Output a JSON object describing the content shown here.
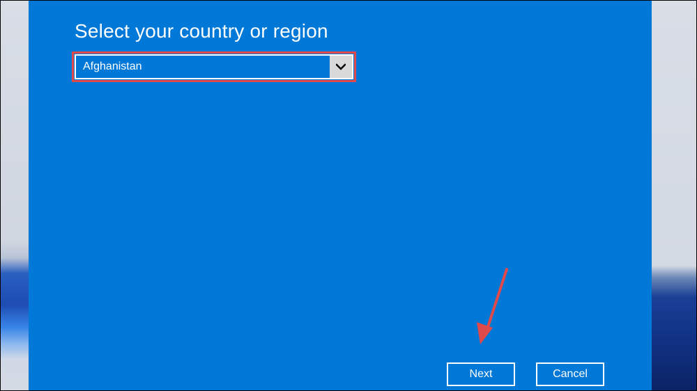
{
  "setup": {
    "title": "Select your country or region",
    "country_select": {
      "selected": "Afghanistan"
    },
    "buttons": {
      "next": "Next",
      "cancel": "Cancel"
    }
  },
  "colors": {
    "oobe_background": "#0078d7",
    "text": "#ffffff",
    "highlight": "#e04a4a",
    "dropdown_arrow_bg": "#d9d9d9"
  },
  "icons": {
    "dropdown": "chevron-down-icon",
    "annotation": "arrow-annotation"
  }
}
